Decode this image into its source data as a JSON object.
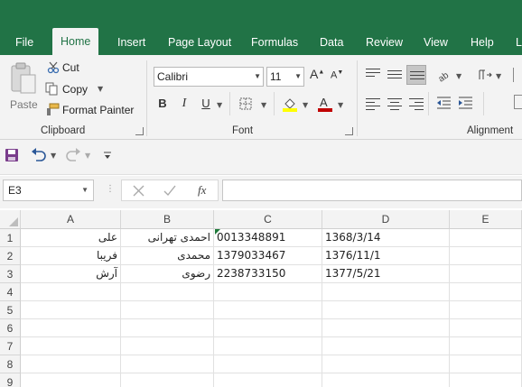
{
  "tabs": [
    "File",
    "Home",
    "Insert",
    "Page Layout",
    "Formulas",
    "Data",
    "Review",
    "View",
    "Help",
    "L"
  ],
  "active_tab": "Home",
  "clipboard": {
    "paste_label": "Paste",
    "cut_label": "Cut",
    "copy_label": "Copy",
    "format_painter_label": "Format Painter",
    "group_label": "Clipboard"
  },
  "font": {
    "font_name": "Calibri",
    "font_size": "11",
    "bold": "B",
    "italic": "I",
    "underline": "U",
    "group_label": "Font"
  },
  "alignment": {
    "group_label": "Alignment"
  },
  "name_box": "E3",
  "formula_fx": "fx",
  "formula_value": "",
  "columns": [
    "A",
    "B",
    "C",
    "D",
    "E"
  ],
  "rows": [
    "1",
    "2",
    "3",
    "4",
    "5",
    "6",
    "7",
    "8",
    "9"
  ],
  "cells": [
    [
      "علی",
      "احمدی تهرانی",
      "0013348891",
      "1368/3/14",
      ""
    ],
    [
      "فریبا",
      "محمدی",
      "1379033467",
      "1376/11/1",
      ""
    ],
    [
      "آرش",
      "رضوی",
      "2238733150",
      "1377/5/21",
      ""
    ]
  ],
  "colors": {
    "brand": "#217346",
    "ribbon_bg": "#f3f3f3",
    "font_color_bar": "#c00000",
    "highlight_bar": "#ffff00"
  }
}
